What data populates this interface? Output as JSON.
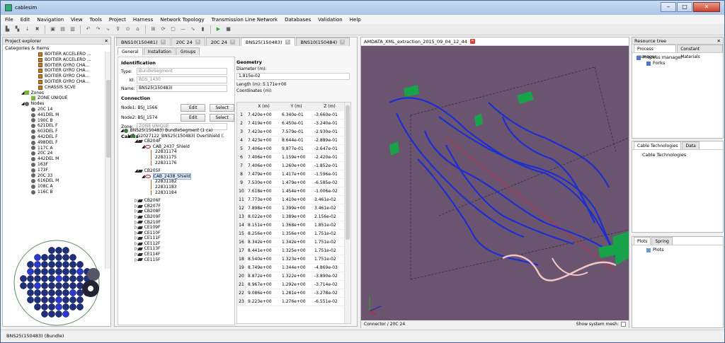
{
  "app": {
    "title": "cablesim"
  },
  "menu": [
    "File",
    "Edit",
    "Navigation",
    "View",
    "Tools",
    "Project",
    "Harness",
    "Network Topology",
    "Transmission Line Network",
    "Databases",
    "Validation",
    "Help"
  ],
  "left": {
    "title": "Project explorer",
    "subtitle": "Categories & Items",
    "items": [
      "BOITIER ACCELERO ...",
      "BOITIER ACCELERO ...",
      "BOITIER GYRO CHA...",
      "BOITIER GYRO CHA...",
      "BOITIER GYRO CHA...",
      "BOITIER GYRO CHA...",
      "CHASSIS SCVE"
    ],
    "zones_label": "Zones",
    "zone_item": "ZONE UNIQUE",
    "nodes_label": "Nodes",
    "nodes": [
      "20C  14",
      "441DEL  M",
      "190C  B",
      "621DEL  F",
      "603DEL  F",
      "442DEL  F",
      "498DEL  F",
      "117C  A",
      "20C  24",
      "442DEL  M",
      "163F",
      "173F",
      "20C  33",
      "616DEL  M",
      "108C  A",
      "116C  B"
    ]
  },
  "center": {
    "tabs": [
      "BNS10(150481)",
      "20C  24",
      "20C  24",
      "BNS25(150483)",
      "BNS10(150484)"
    ],
    "subtabs": [
      "General",
      "Installation",
      "Groups"
    ],
    "ident_title": "Identification",
    "type_label": "Type:",
    "type_val": "BundleSegment",
    "id_label": "Id:",
    "id_val": "BDS_1430",
    "name_label": "Name:",
    "name_val": "BNS25(150483)",
    "conn_title": "Connection",
    "node1_label": "Node1: BSJ_1566",
    "node2_label": "Node2: BSJ_1574",
    "edit": "Edit",
    "select": "Select",
    "zone_label": "Zone:",
    "zone_val": "ZONE UNIQUE",
    "cables_title": "Cables",
    "cables": [
      {
        "t": "BNS25(150483) BundleSegment (1 ca)",
        "d": 0
      },
      {
        "t": "G2027122_BNS25(150483) OverShield (3...",
        "d": 1
      },
      {
        "t": "CB204F",
        "d": 2
      },
      {
        "t": "CAB_2437_Shield",
        "d": 3
      },
      {
        "t": "22831174",
        "d": 4
      },
      {
        "t": "22831175",
        "d": 4
      },
      {
        "t": "22831176",
        "d": 4
      },
      {
        "t": "",
        "d": 4
      },
      {
        "t": "CB205F",
        "d": 2
      },
      {
        "t": "CAB_2438_Shield",
        "d": 3
      },
      {
        "t": "22831182",
        "d": 4
      },
      {
        "t": "22831183",
        "d": 4
      },
      {
        "t": "22831184",
        "d": 4
      },
      {
        "t": "",
        "d": 4
      },
      {
        "t": "CB206F",
        "d": 2
      },
      {
        "t": "CB207F",
        "d": 2
      },
      {
        "t": "CB208F",
        "d": 2
      },
      {
        "t": "CB209F",
        "d": 2
      },
      {
        "t": "CB210F",
        "d": 2
      },
      {
        "t": "CE109F",
        "d": 2
      },
      {
        "t": "CE110F",
        "d": 2
      },
      {
        "t": "CE111F",
        "d": 2
      },
      {
        "t": "CE112F",
        "d": 2
      },
      {
        "t": "CE113F",
        "d": 2
      },
      {
        "t": "CE114F",
        "d": 2
      },
      {
        "t": "CE115F",
        "d": 2
      }
    ],
    "geo_title": "Geometry",
    "diam_label": "Diameter (m):",
    "diam_val": "1.815e-02",
    "length_label": "Length (m): 5.171e+00",
    "coords_label": "Coordinates (m):",
    "cols": [
      "X (m)",
      "Y (m)",
      "Z (m)"
    ],
    "rows": [
      [
        "1",
        "7.420e+00",
        "6.340e-01",
        "-3.660e-01"
      ],
      [
        "2",
        "7.419e+00",
        "6.450e-01",
        "-3.240e-01"
      ],
      [
        "3",
        "7.423e+00",
        "7.579e-01",
        "-2.930e-01"
      ],
      [
        "4",
        "7.423e+00",
        "8.644e-01",
        "-2.889e-01"
      ],
      [
        "5",
        "7.406e+00",
        "9.877e-01",
        "-2.647e-01"
      ],
      [
        "6",
        "7.406e+00",
        "1.159e+00",
        "-2.420e-01"
      ],
      [
        "7",
        "7.406e+00",
        "1.260e+00",
        "-1.852e-01"
      ],
      [
        "8",
        "7.479e+00",
        "1.417e+00",
        "-1.596e-01"
      ],
      [
        "9",
        "7.530e+00",
        "1.479e+00",
        "-6.585e-02"
      ],
      [
        "10",
        "7.618e+00",
        "1.454e+00",
        "-1.006e-02"
      ],
      [
        "11",
        "7.773e+00",
        "1.410e+00",
        "3.461e-02"
      ],
      [
        "12",
        "7.898e+00",
        "1.399e+00",
        "3.461e-02"
      ],
      [
        "13",
        "8.022e+00",
        "1.389e+00",
        "2.156e-02"
      ],
      [
        "14",
        "8.151e+00",
        "1.368e+00",
        "1.851e-02"
      ],
      [
        "15",
        "8.256e+00",
        "1.356e+00",
        "1.751e-02"
      ],
      [
        "16",
        "8.342e+00",
        "1.342e+00",
        "1.751e-02"
      ],
      [
        "17",
        "8.441e+00",
        "1.325e+00",
        "1.751e-02"
      ],
      [
        "18",
        "8.540e+00",
        "1.323e+00",
        "1.751e-02"
      ],
      [
        "19",
        "8.749e+00",
        "1.344e+00",
        "-4.869e-03"
      ],
      [
        "20",
        "8.872e+00",
        "1.322e+00",
        "-3.890e-02"
      ],
      [
        "21",
        "8.967e+00",
        "1.292e+00",
        "-3.714e-02"
      ],
      [
        "22",
        "9.086e+00",
        "1.281e+00",
        "-3.278e-02"
      ],
      [
        "23",
        "9.223e+00",
        "1.276e+00",
        "-6.551e-02"
      ]
    ]
  },
  "view": {
    "tab": "AMDATA_XML_extraction_2015_09_04_12_44",
    "status_left": "Connector /  20C  24",
    "show_mesh": "Show system mesh:",
    "bg_color": "#6a5470"
  },
  "right": {
    "title": "Resource tree",
    "tabs1": [
      "Process manager",
      "Constant Materials"
    ],
    "pm": "Process manager",
    "forks": "Forks",
    "tabs2": [
      "Cable Technologies",
      "Data"
    ],
    "ct": "Cable Technologies",
    "tabs3": [
      "Plots",
      "Spring"
    ],
    "plots": "Plots"
  },
  "statusbar": "BNS25(150483) (Bundle)"
}
